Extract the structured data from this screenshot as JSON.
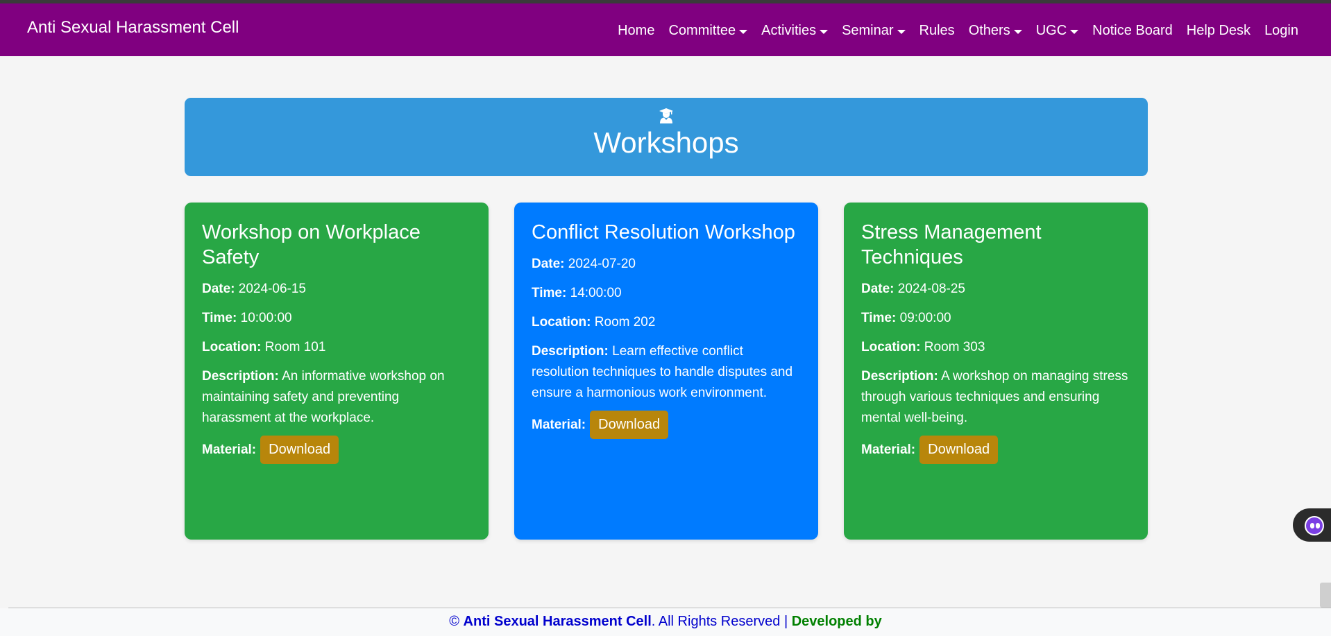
{
  "navbar": {
    "brand": "Anti Sexual Harassment Cell",
    "items": [
      {
        "label": "Home",
        "dropdown": false
      },
      {
        "label": "Committee",
        "dropdown": true
      },
      {
        "label": "Activities",
        "dropdown": true
      },
      {
        "label": "Seminar",
        "dropdown": true
      },
      {
        "label": "Rules",
        "dropdown": false
      },
      {
        "label": "Others",
        "dropdown": true
      },
      {
        "label": "UGC",
        "dropdown": true
      },
      {
        "label": "Notice Board",
        "dropdown": false
      },
      {
        "label": "Help Desk",
        "dropdown": false
      },
      {
        "label": "Login",
        "dropdown": false
      }
    ]
  },
  "hero": {
    "icon": "user-graduate-icon",
    "title": "Workshops"
  },
  "labels": {
    "date": "Date:",
    "time": "Time:",
    "location": "Location:",
    "description": "Description:",
    "material": "Material:",
    "download": "Download"
  },
  "workshops": [
    {
      "title": "Workshop on Workplace Safety",
      "date": "2024-06-15",
      "time": "10:00:00",
      "location": "Room 101",
      "description": "An informative workshop on maintaining safety and preventing harassment at the workplace.",
      "color": "#28a745"
    },
    {
      "title": "Conflict Resolution Workshop",
      "date": "2024-07-20",
      "time": "14:00:00",
      "location": "Room 202",
      "description": "Learn effective conflict resolution techniques to handle disputes and ensure a harmonious work environment.",
      "color": "#007bff"
    },
    {
      "title": "Stress Management Techniques",
      "date": "2024-08-25",
      "time": "09:00:00",
      "location": "Room 303",
      "description": "A workshop on managing stress through various techniques and ensuring mental well-being.",
      "color": "#28a745"
    }
  ],
  "footer": {
    "copyright": "©",
    "org": "Anti Sexual Harassment Cell",
    "rights": ". All Rights Reserved |",
    "developed": "Developed by"
  },
  "colors": {
    "navbar": "#800080",
    "hero": "#3498db",
    "download_button": "#b8860b"
  }
}
